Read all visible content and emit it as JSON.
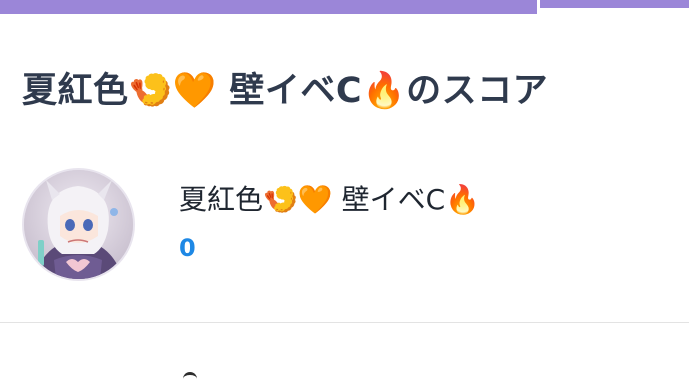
{
  "progress": {
    "fraction": 0.78,
    "color": "#9b86d8"
  },
  "page_title": {
    "name": "夏紅色",
    "emoji_1": "🍤",
    "emoji_2": "🧡",
    "group": "壁イベC",
    "emoji_3": "🔥",
    "suffix": "のスコア"
  },
  "profile": {
    "name": "夏紅色",
    "emoji_1": "🍤",
    "emoji_2": "🧡",
    "group": "壁イベC",
    "emoji_3": "🔥",
    "score": "0",
    "avatar_icon": "anime-character-avatar"
  },
  "colors": {
    "title": "#2f3a4d",
    "score": "#1e88e5",
    "divider": "#e3e3e3"
  }
}
